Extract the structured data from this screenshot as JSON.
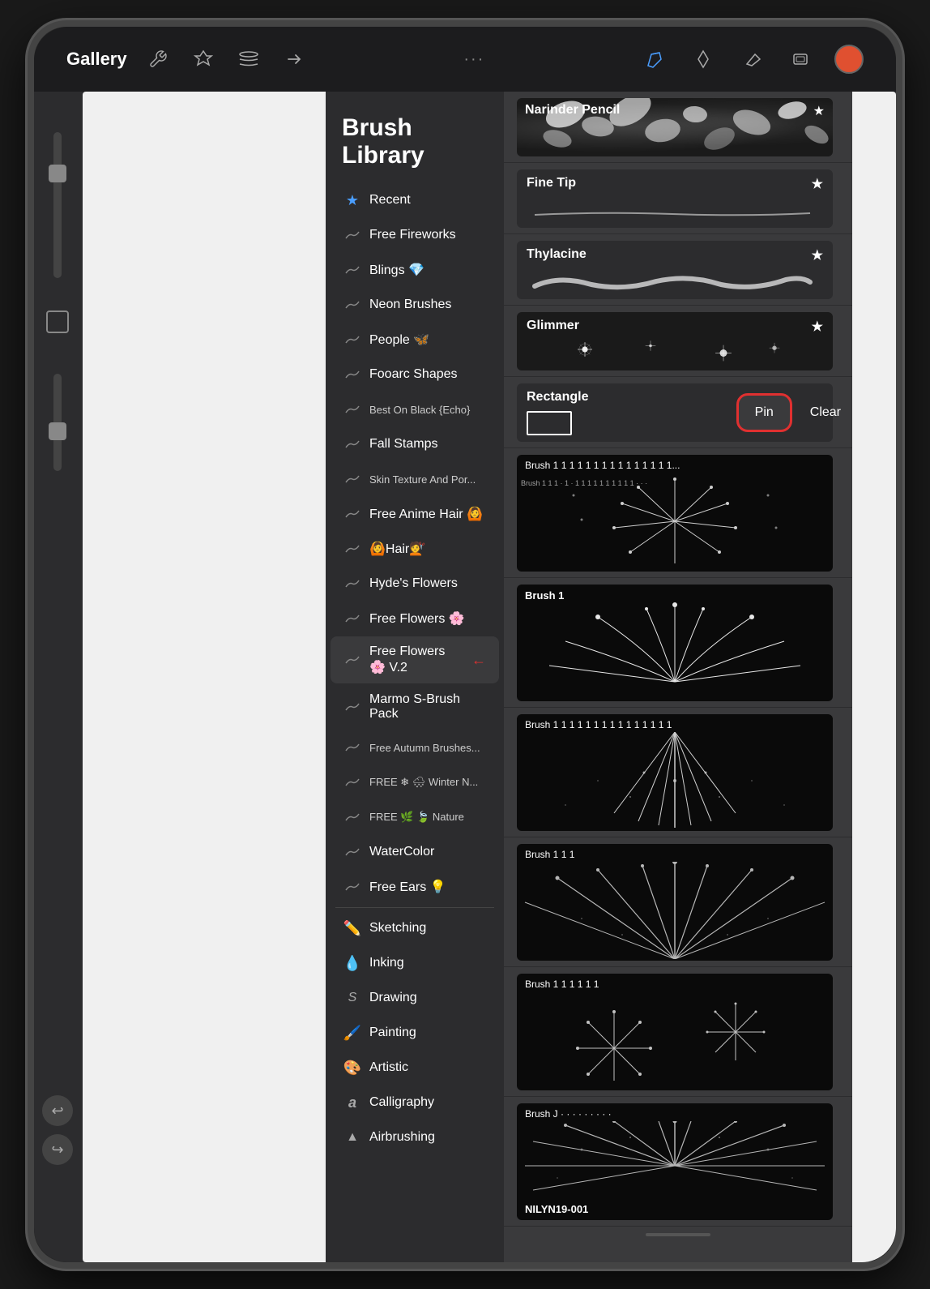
{
  "device": {
    "background": "#1c1c1e"
  },
  "topbar": {
    "gallery_label": "Gallery",
    "dots": "···",
    "tool_active": "pencil"
  },
  "brush_library": {
    "title": "Brush Library",
    "categories": [
      {
        "id": "recent",
        "icon": "⭐",
        "label": "Recent",
        "icon_type": "star"
      },
      {
        "id": "free-fireworks",
        "icon": "〜",
        "label": "Free Fireworks",
        "icon_type": "brush"
      },
      {
        "id": "blings",
        "icon": "〜",
        "label": "Blings 💎",
        "icon_type": "brush"
      },
      {
        "id": "neon-brushes",
        "icon": "〜",
        "label": "Neon Brushes",
        "icon_type": "brush"
      },
      {
        "id": "people",
        "icon": "〜",
        "label": "People 🦋",
        "icon_type": "brush"
      },
      {
        "id": "fooarc",
        "icon": "〜",
        "label": "Fooarc Shapes",
        "icon_type": "brush"
      },
      {
        "id": "best-on-black",
        "icon": "〜",
        "label": "Best On Black {Echo}",
        "icon_type": "brush",
        "small": true
      },
      {
        "id": "fall-stamps",
        "icon": "〜",
        "label": "Fall Stamps",
        "icon_type": "brush"
      },
      {
        "id": "skin-texture",
        "icon": "〜",
        "label": "Skin Texture And Por...",
        "icon_type": "brush",
        "small": true
      },
      {
        "id": "free-anime-hair",
        "icon": "〜",
        "label": "Free Anime Hair 🙆",
        "icon_type": "brush"
      },
      {
        "id": "hair",
        "icon": "〜",
        "label": "🙆Hair💇",
        "icon_type": "brush"
      },
      {
        "id": "hydes-flowers",
        "icon": "〜",
        "label": "Hyde's Flowers",
        "icon_type": "brush"
      },
      {
        "id": "free-flowers",
        "icon": "〜",
        "label": "Free Flowers 🌸",
        "icon_type": "brush"
      },
      {
        "id": "free-flowers-v2",
        "icon": "〜",
        "label": "Free Flowers 🌸 V.2",
        "icon_type": "brush",
        "active": true
      },
      {
        "id": "marmo",
        "icon": "〜",
        "label": "Marmo S-Brush Pack",
        "icon_type": "brush"
      },
      {
        "id": "free-autumn",
        "icon": "〜",
        "label": "Free Autumn Brushes...",
        "icon_type": "brush",
        "small": true
      },
      {
        "id": "free-winter",
        "icon": "〜",
        "label": "FREE ❄ 🌨 Winter N...",
        "icon_type": "brush",
        "small": true
      },
      {
        "id": "free-nature",
        "icon": "〜",
        "label": "FREE 🌿 🍃 Nature",
        "icon_type": "brush",
        "small": true
      },
      {
        "id": "watercolor",
        "icon": "〜",
        "label": "WaterColor",
        "icon_type": "brush"
      },
      {
        "id": "free-ears",
        "icon": "〜",
        "label": "Free Ears 💡",
        "icon_type": "brush"
      },
      {
        "id": "sketching",
        "icon": "✏",
        "label": "Sketching",
        "icon_type": "pencil"
      },
      {
        "id": "inking",
        "icon": "💧",
        "label": "Inking",
        "icon_type": "ink"
      },
      {
        "id": "drawing",
        "icon": "S",
        "label": "Drawing",
        "icon_type": "draw"
      },
      {
        "id": "painting",
        "icon": "🖌",
        "label": "Painting",
        "icon_type": "paint"
      },
      {
        "id": "artistic",
        "icon": "🎨",
        "label": "Artistic",
        "icon_type": "art"
      },
      {
        "id": "calligraphy",
        "icon": "a",
        "label": "Calligraphy",
        "icon_type": "calli"
      },
      {
        "id": "airbrushing",
        "icon": "▲",
        "label": "Airbrushing",
        "icon_type": "air"
      }
    ],
    "brushes": [
      {
        "id": "narinder-pencil",
        "name": "Narinder Pencil",
        "star": true,
        "preview_type": "floral-dark"
      },
      {
        "id": "fine-tip",
        "name": "Fine Tip",
        "star": true,
        "preview_type": "stroke-light"
      },
      {
        "id": "thylacine",
        "name": "Thylacine",
        "star": true,
        "preview_type": "stroke-thick"
      },
      {
        "id": "glimmer",
        "name": "Glimmer",
        "star": true,
        "preview_type": "sparkle"
      },
      {
        "id": "rectangle",
        "name": "Rectangle",
        "star": false,
        "preview_type": "rectangle"
      },
      {
        "id": "fireworks1",
        "name": "Brush 1 1 1 1 1 1 1 1 1 1 1 1 1 1 1...",
        "preview_type": "fireworks"
      },
      {
        "id": "fireworks2",
        "name": "Brush 1",
        "preview_type": "fireworks2"
      },
      {
        "id": "fireworks3",
        "name": "Brush 1 1 1 1 1 1 1 1 1 1 1 1 1 1 1",
        "preview_type": "fireworks3"
      },
      {
        "id": "fireworks4",
        "name": "Brush 1 1 1",
        "preview_type": "fireworks4"
      },
      {
        "id": "fireworks5",
        "name": "Brush 1 1 1 1 1 1",
        "preview_type": "fireworks5"
      },
      {
        "id": "nilyn",
        "name": "NILYN19-001",
        "preview_type": "fireworks6"
      }
    ],
    "pin_label": "Pin",
    "clear_label": "Clear",
    "active_category_id": "free-flowers-v2"
  }
}
